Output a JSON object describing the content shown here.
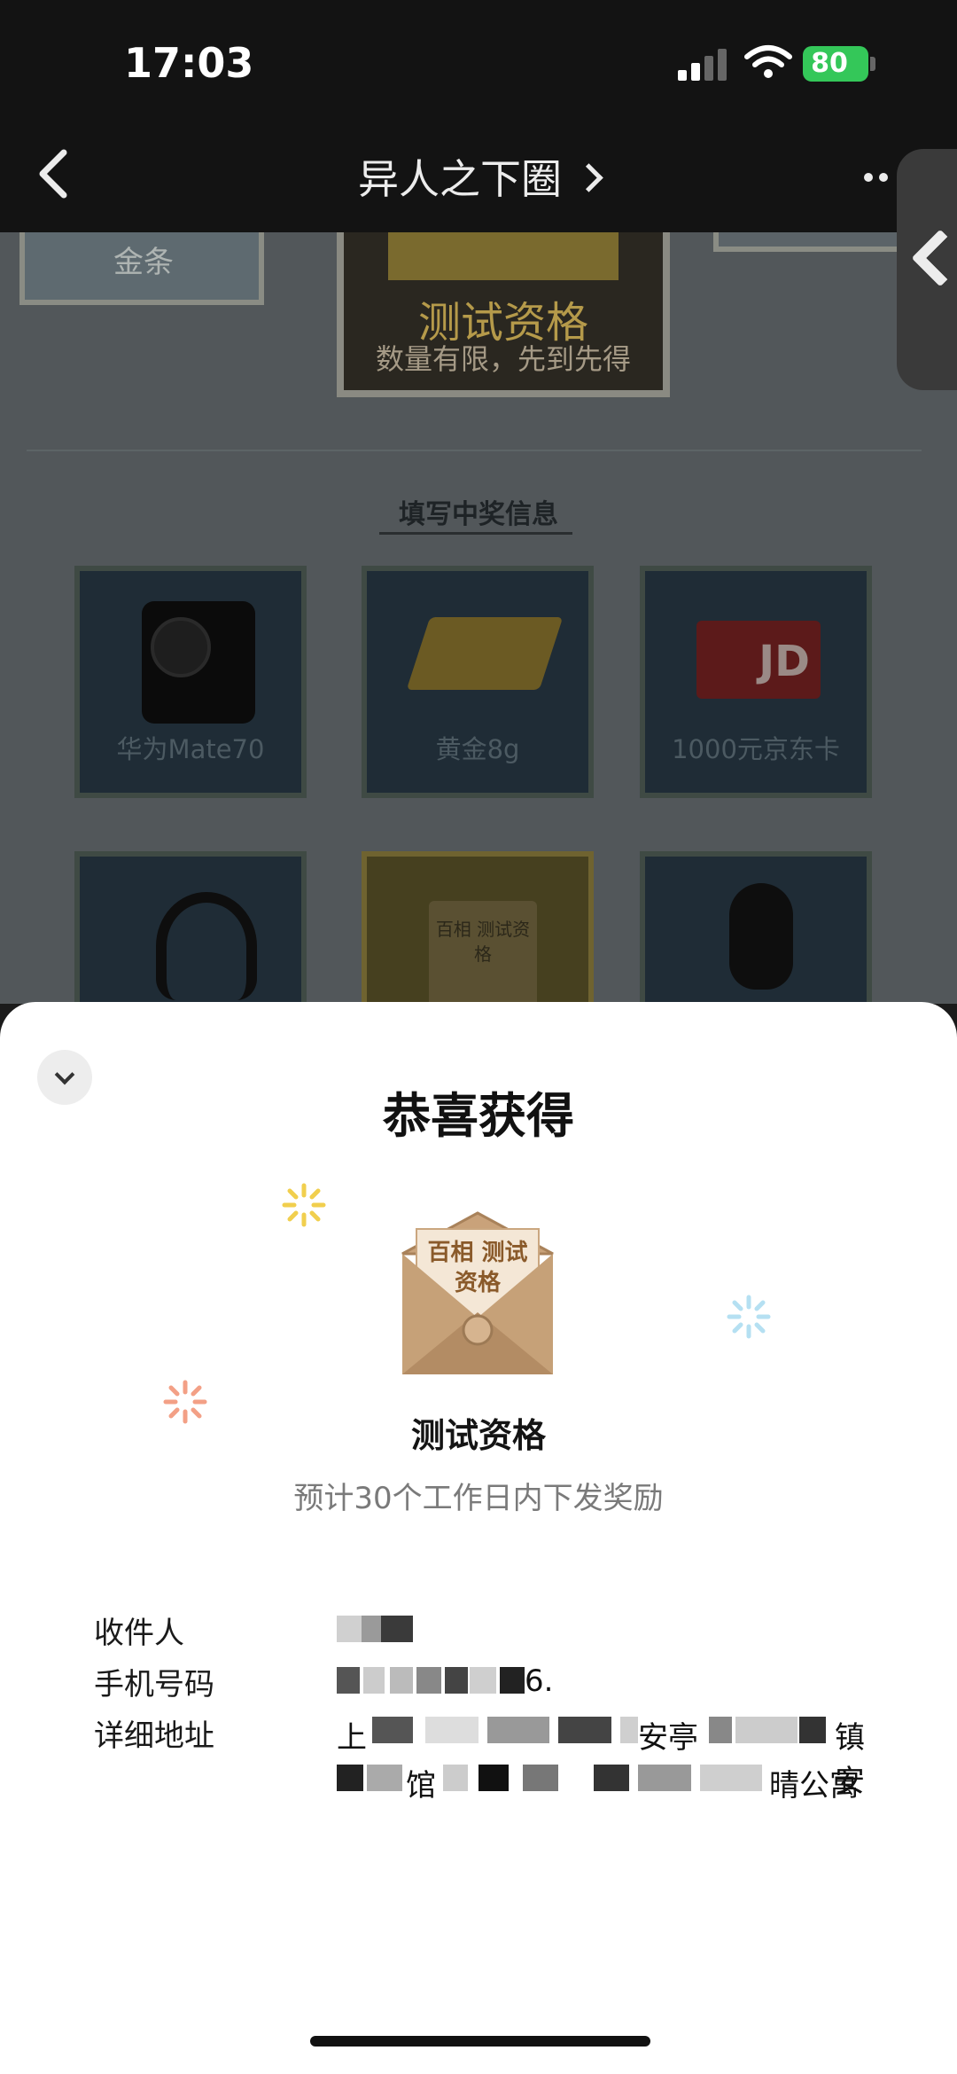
{
  "status_bar": {
    "time": "17:03",
    "battery": "80"
  },
  "nav": {
    "title": "异人之下圈"
  },
  "background_page": {
    "frame_left_text": "金条",
    "card_title": "测试资格",
    "card_subtitle": "数量有限，先到先得",
    "section_heading": "填写中奖信息",
    "prizes": [
      {
        "label": "华为Mate70",
        "icon": "phone-icon"
      },
      {
        "label": "黄金8g",
        "icon": "gold-bar-icon"
      },
      {
        "label": "1000元京东卡",
        "icon": "jd-card-icon",
        "card_logo": "JD"
      },
      {
        "label": "",
        "icon": "headset-icon"
      },
      {
        "label": "",
        "icon": "envelope-icon",
        "envelope_text": "百相 测试资格"
      },
      {
        "label": "",
        "icon": "mouse-icon"
      }
    ]
  },
  "sheet": {
    "title": "恭喜获得",
    "prize_image_text": "百相 测试资格",
    "prize_name": "测试资格",
    "prize_note": "预计30个工作日内下发奖励",
    "fields": {
      "recipient_label": "收件人",
      "phone_label": "手机号码",
      "address_label": "详细地址"
    },
    "visible_fragments": {
      "phone_end": "6.",
      "addr_line1_a": "上",
      "addr_line1_b": "安亭",
      "addr_line1_c": "镇安",
      "addr_line2_a": "馆",
      "addr_line2_b": "晴公寓"
    }
  },
  "colors": {
    "battery": "#34c759",
    "accent_gold": "#b59a4a"
  }
}
